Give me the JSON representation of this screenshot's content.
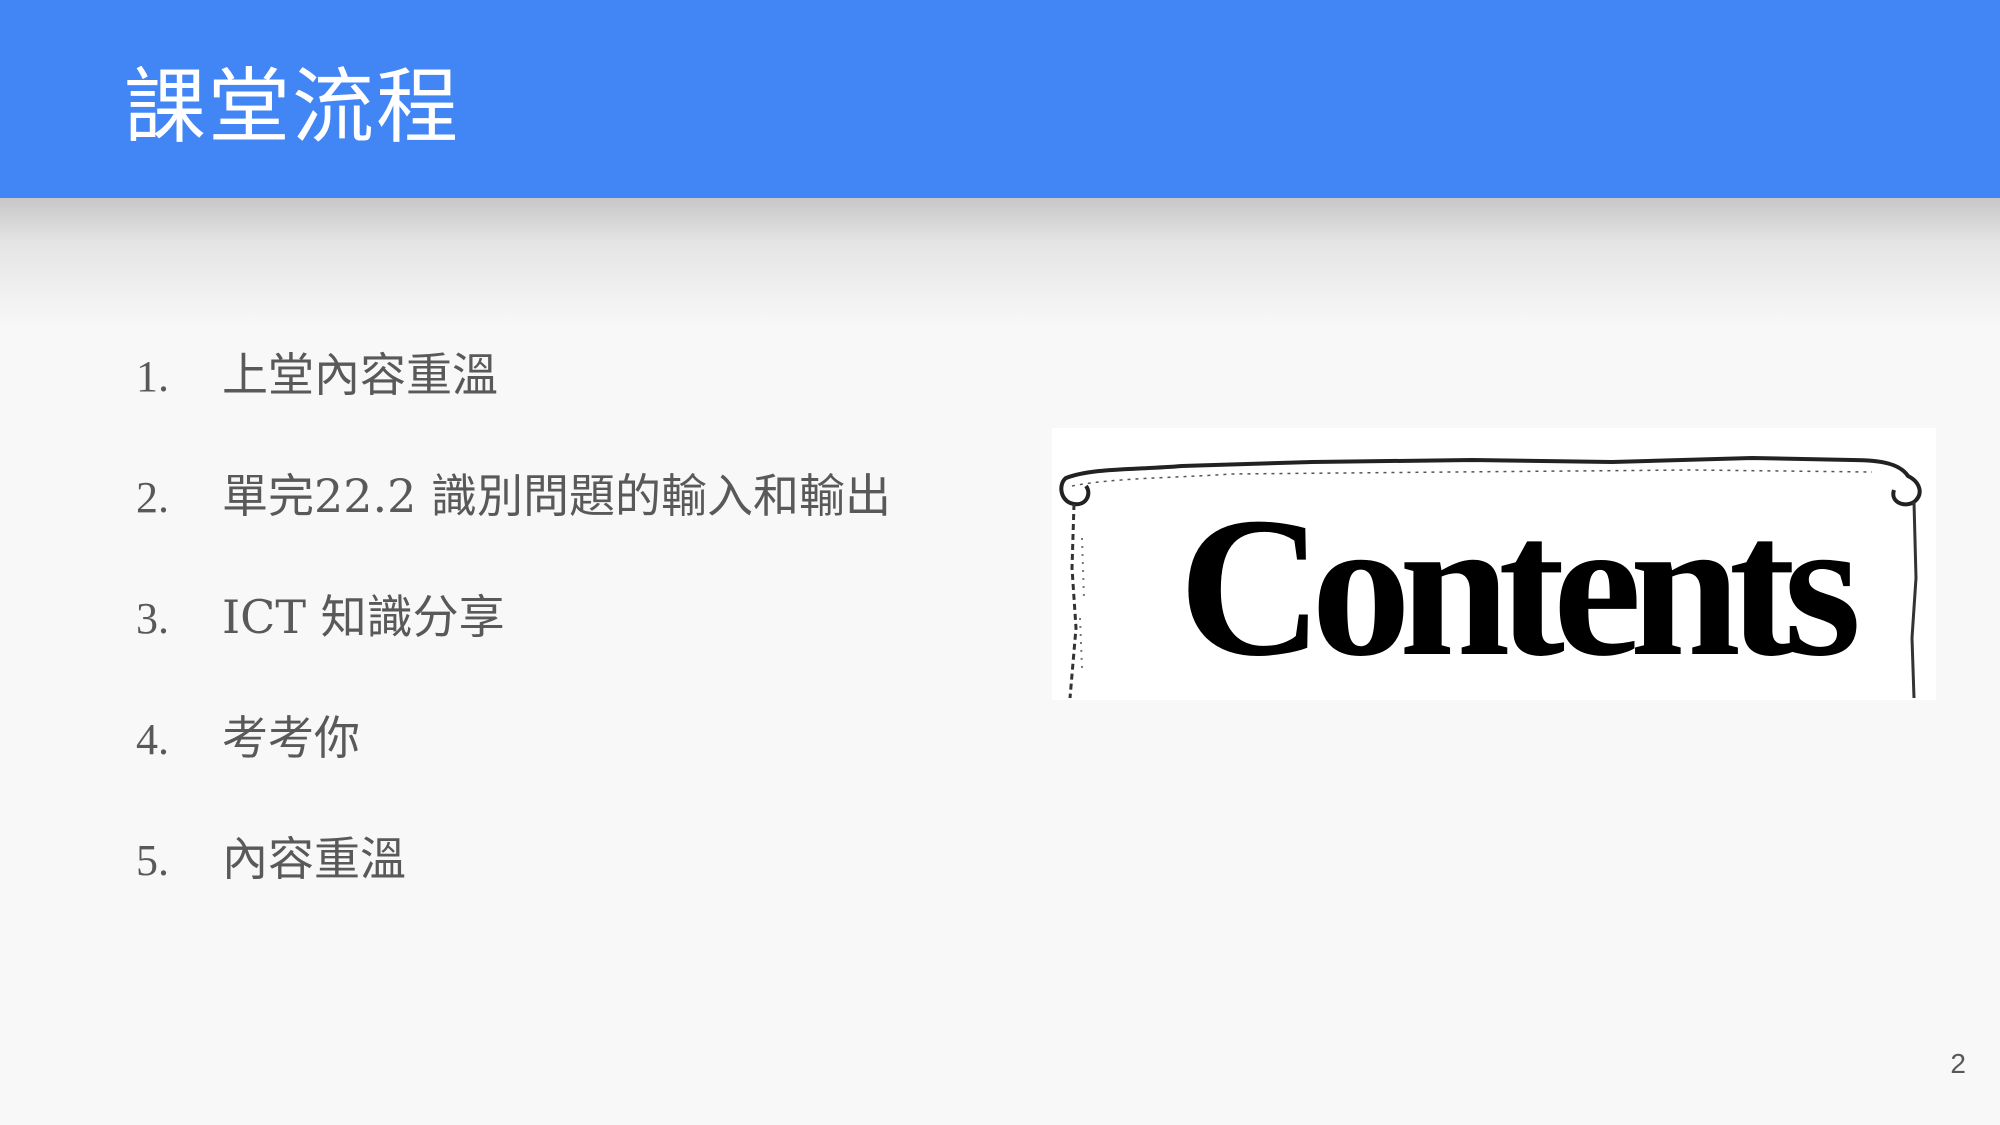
{
  "slide": {
    "title": "課堂流程",
    "page_number": "2"
  },
  "agenda": {
    "items": [
      {
        "number": "1.",
        "text": "上堂內容重溫"
      },
      {
        "number": "2.",
        "text": "單完22.2 識別問題的輸入和輸出"
      },
      {
        "number": "3.",
        "text": "ICT 知識分享"
      },
      {
        "number": "4.",
        "text": "考考你"
      },
      {
        "number": "5.",
        "text": "內容重溫"
      }
    ]
  },
  "image": {
    "word": "Contents",
    "description_icon": "contents-scroll-image"
  },
  "colors": {
    "header": "#4285f4",
    "background": "#f8f8f8",
    "body_text": "#595959",
    "title_text": "#ffffff"
  }
}
